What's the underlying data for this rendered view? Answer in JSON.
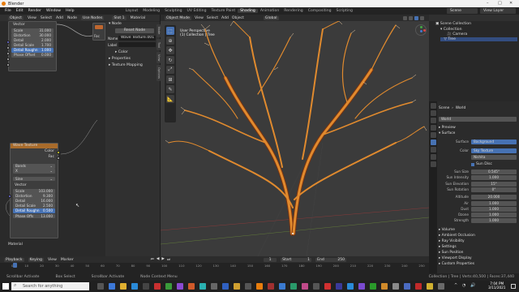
{
  "title_bar": {
    "title": "Blender"
  },
  "menu": [
    "File",
    "Edit",
    "Render",
    "Window",
    "Help"
  ],
  "workspaces": [
    "Layout",
    "Modeling",
    "Sculpting",
    "UV Editing",
    "Texture Paint",
    "Shading",
    "Animation",
    "Rendering",
    "Compositing",
    "Scripting"
  ],
  "active_workspace": "Shading",
  "scene": "Scene",
  "view_layer": "View Layer",
  "node_editor": {
    "header": {
      "object": "Object",
      "view": "View",
      "select": "Select",
      "add": "Add",
      "node": "Node",
      "use_nodes": "Use Nodes",
      "slot": "Slot 1",
      "material": "Material"
    },
    "top_node": {
      "section": "Vector",
      "fields": [
        {
          "label": "Scale",
          "value": "31.000"
        },
        {
          "label": "Distortion",
          "value": "30.000"
        },
        {
          "label": "Detail",
          "value": "2.000"
        },
        {
          "label": "Detail Scale",
          "value": "1.700"
        },
        {
          "label": "Detail Roughn",
          "value": "1.000",
          "selected": true
        },
        {
          "label": "Phase Offset",
          "value": "0.000"
        }
      ]
    },
    "fac_label": "Fac",
    "wave_node": {
      "title": "Wave Texture",
      "out_color": "Color",
      "out_fac": "Fac",
      "type": "Bands",
      "direction": "X",
      "profile": "Sine",
      "section": "Vector",
      "fields": [
        {
          "label": "Scale",
          "value": "103.000"
        },
        {
          "label": "Distortion",
          "value": "9.300"
        },
        {
          "label": "Detail",
          "value": "16.000"
        },
        {
          "label": "Detail Scale",
          "value": "2.500"
        },
        {
          "label": "Detail Roughn",
          "value": "0.500",
          "selected": true
        },
        {
          "label": "Phase Offs",
          "value": "13.000"
        }
      ]
    },
    "material_label": "Material"
  },
  "node_sidebar": {
    "section": "Node",
    "tab": "Reset Node",
    "name_label": "Name",
    "name_value": "Wave Texture.001",
    "label_label": "Label",
    "color": "Color",
    "properties": "Properties",
    "texture_mapping": "Texture Mapping",
    "tabs": [
      "Node",
      "Tool",
      "View",
      "Options"
    ]
  },
  "viewport": {
    "header": {
      "mode": "Object Mode",
      "view": "View",
      "select": "Select",
      "add": "Add",
      "object": "Object",
      "transform": "Global"
    },
    "overlay_text": [
      "User Perspective",
      "(1) Collection | Tree"
    ]
  },
  "outliner": {
    "title": "Scene Collection",
    "items": [
      "Collection",
      "Camera",
      "Tree"
    ]
  },
  "properties": {
    "scene": "Scene",
    "world": "World",
    "world_field": "World",
    "preview": "Preview",
    "surface_section": "Surface",
    "surface": {
      "label": "Surface",
      "value": "Background"
    },
    "color": {
      "label": "Color",
      "value": "Sky Texture"
    },
    "sky_type": "Nishita",
    "sun_disc": "Sun Disc",
    "rows": [
      {
        "label": "Sun Size",
        "value": "0.545°"
      },
      {
        "label": "Sun Intensity",
        "value": "1.000"
      },
      {
        "label": "Sun Elevation",
        "value": "15°"
      },
      {
        "label": "Sun Rotation",
        "value": "0°"
      },
      {
        "label": "Altitude",
        "value": "20.000"
      },
      {
        "label": "Air",
        "value": "1.000"
      },
      {
        "label": "Dust",
        "value": "1.000"
      },
      {
        "label": "Ozone",
        "value": "1.000"
      },
      {
        "label": "Strength",
        "value": "1.000"
      }
    ],
    "sections": [
      "Volume",
      "Ambient Occlusion",
      "Ray Visibility",
      "Settings",
      "Sun Position",
      "Viewport Display",
      "Custom Properties"
    ]
  },
  "timeline": {
    "playback": "Playback",
    "keying": "Keying",
    "view": "View",
    "marker": "Marker",
    "current": "1",
    "start_label": "Start",
    "start": "1",
    "end_label": "End",
    "end": "250",
    "ticks": [
      "0",
      "10",
      "20",
      "30",
      "40",
      "50",
      "60",
      "70",
      "80",
      "90",
      "100",
      "110",
      "120",
      "130",
      "140",
      "150",
      "160",
      "170",
      "180",
      "190",
      "200",
      "210",
      "220",
      "230",
      "240",
      "250"
    ]
  },
  "status": [
    "Scrollbar Activate",
    "Box Select",
    "Scrollbar Activate",
    "Node Context Menu",
    "Collection | Tree | Verts:40,500 | Faces:37,440"
  ],
  "taskbar": {
    "search_placeholder": "Search for anything",
    "time": "7:04 PM",
    "date": "3/11/2021"
  },
  "colors": {
    "accent": "#4772b3",
    "tree": "#e08a2e",
    "node_header": "#a86b2b"
  }
}
